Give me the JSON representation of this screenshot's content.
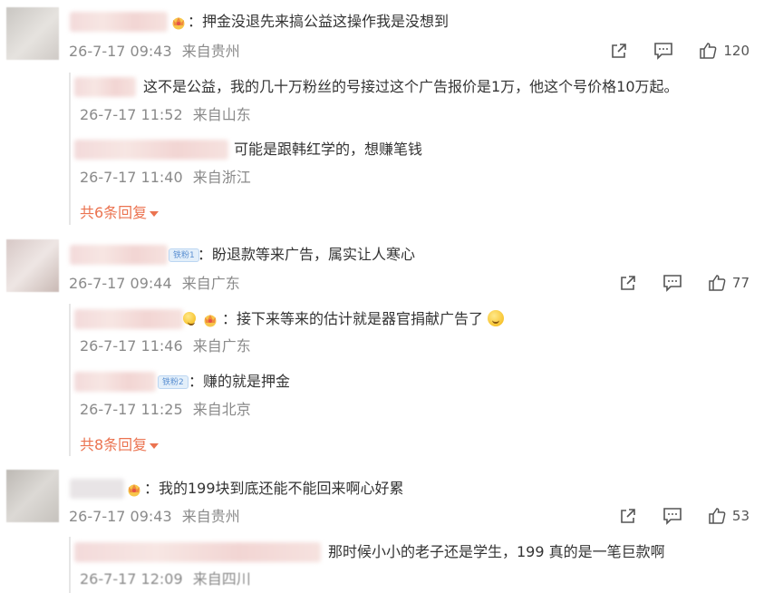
{
  "threads": [
    {
      "comment": {
        "text": "：押金没退先来搞公益这操作我是没想到",
        "date": "26-7-17 09:43",
        "location": "来自贵州",
        "likes": "120"
      },
      "replies": [
        {
          "text": "这不是公益，我的几十万粉丝的号接过这个广告报价是1万，他这个号价格10万起。",
          "date": "26-7-17 11:52",
          "location": "来自山东"
        },
        {
          "text": "可能是跟韩红学的，想赚笔钱",
          "date": "26-7-17 11:40",
          "location": "来自浙江"
        }
      ],
      "more_label": "共6条回复"
    },
    {
      "comment": {
        "fan_badge": "铁粉1",
        "text": "：盼退款等来广告，属实让人寒心",
        "date": "26-7-17 09:44",
        "location": "来自广东",
        "likes": "77"
      },
      "replies": [
        {
          "text": "：接下来等来的估计就是器官捐献广告了",
          "date": "26-7-17 11:46",
          "location": "来自广东"
        },
        {
          "fan_badge": "铁粉2",
          "text": "：赚的就是押金",
          "date": "26-7-17 11:25",
          "location": "来自北京"
        }
      ],
      "more_label": "共8条回复"
    },
    {
      "comment": {
        "text": "：我的199块到底还能不能回来啊心好累",
        "date": "26-7-17 09:43",
        "location": "来自贵州",
        "likes": "53"
      },
      "replies": [
        {
          "text": "那时候小小的老子还是学生，199 真的是一笔巨款啊",
          "date": "26-7-17 12:09",
          "location": "来自四川"
        }
      ]
    }
  ],
  "icons": {
    "share": "share-icon",
    "comment": "comment-icon",
    "like": "thumbs-up-icon",
    "crown": "crown-badge-icon",
    "emoji": "smile-emoji-icon",
    "more_arrow": "caret-down-icon"
  },
  "colors": {
    "link_orange": "#eb7350",
    "meta_gray": "#8a8a8a",
    "fan_badge_blue": "#5a8fd1"
  }
}
